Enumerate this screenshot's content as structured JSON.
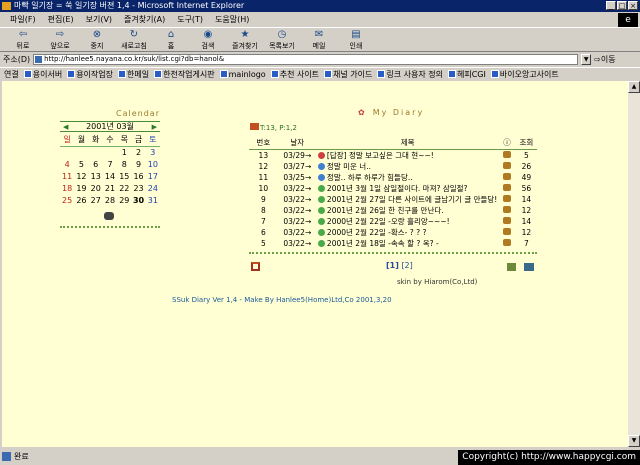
{
  "window": {
    "title": "마빡 일기장 = 쑥 일기장 버젼 1,4 - Microsoft Internet Explorer"
  },
  "menu": [
    "파일(F)",
    "편집(E)",
    "보기(V)",
    "즐겨찾기(A)",
    "도구(T)",
    "도움말(H)"
  ],
  "toolbar": {
    "back": "뒤로",
    "forward": "앞으로",
    "stop": "중지",
    "refresh": "새로고침",
    "home": "홈",
    "search": "검색",
    "favorites": "즐겨찾기",
    "history": "목록보기",
    "mail": "메일",
    "print": "인쇄"
  },
  "address": {
    "label": "주소(D)",
    "url": "http://hanlee5.nayana.co.kr/suk/list.cgi?db=hanol&",
    "go": "이동"
  },
  "links": {
    "label": "연결",
    "items": [
      "용이서버",
      "용이작업장",
      "한메일",
      "한천작업게시판",
      "mainlogo",
      "추천 사이트",
      "채널 가이드",
      "링크 사용자 정의",
      "헤피CGI",
      "바이오앙고사이트"
    ]
  },
  "calendar": {
    "title": "Calendar",
    "month": "2001년 03월",
    "weekdays": [
      "일",
      "월",
      "화",
      "수",
      "목",
      "금",
      "토"
    ],
    "days": [
      "",
      "",
      "",
      "",
      "1",
      "2",
      "3",
      "4",
      "5",
      "6",
      "7",
      "8",
      "9",
      "10",
      "11",
      "12",
      "13",
      "14",
      "15",
      "16",
      "17",
      "18",
      "19",
      "20",
      "21",
      "22",
      "23",
      "24",
      "25",
      "26",
      "27",
      "28",
      "29",
      "30",
      "31"
    ],
    "today": "30"
  },
  "diary": {
    "title": "My Diary",
    "counts": "T:13, P:1,2",
    "headers": {
      "no": "번호",
      "date": "날자",
      "subject": "제목",
      "views": "조회"
    },
    "rows": [
      {
        "no": "13",
        "date": "03/29→",
        "subject": "[답장] 정말 보고싶은 그대 현~~!",
        "views": "5",
        "dot": "#d04040"
      },
      {
        "no": "12",
        "date": "03/27→",
        "subject": "정말 미운 너..",
        "views": "26",
        "dot": "#4080d0"
      },
      {
        "no": "11",
        "date": "03/25→",
        "subject": "정말.. 하루 하루가 힘들당..",
        "views": "49",
        "dot": "#4080d0"
      },
      {
        "no": "10",
        "date": "03/22→",
        "subject": "2001년 3월 1일 삼일절이다. 마져? 삼일절?",
        "views": "56",
        "dot": "#4aaa4a"
      },
      {
        "no": "9",
        "date": "03/22→",
        "subject": "2001년 2월 27일 다른 사이트에 글남기기 글 만들당!",
        "views": "14",
        "dot": "#4aaa4a"
      },
      {
        "no": "8",
        "date": "03/22→",
        "subject": "2001년 2월 26일 한 친구를 만난다.",
        "views": "12",
        "dot": "#4aaa4a"
      },
      {
        "no": "7",
        "date": "03/22→",
        "subject": "2000년 2월 22일 -오랑 흘리앙~~~!",
        "views": "14",
        "dot": "#4aaa4a"
      },
      {
        "no": "6",
        "date": "03/22→",
        "subject": "2000년 2월 22일 -확스- ? ? ?",
        "views": "12",
        "dot": "#4aaa4a"
      },
      {
        "no": "5",
        "date": "03/22→",
        "subject": "2001년 2월 18일 -속속 할 ? 옥? -",
        "views": "7",
        "dot": "#4aaa4a"
      }
    ],
    "pages": [
      "[1]",
      "[2]"
    ],
    "author": "skin by Hiarom(Co,Ltd)"
  },
  "footer": "SSuk Diary Ver 1,4 - Make By Hanlee5(Home)Ltd,Co 2001,3,20",
  "status": "완료",
  "copyright": "Copyright(c) http://www.happycgi.com"
}
